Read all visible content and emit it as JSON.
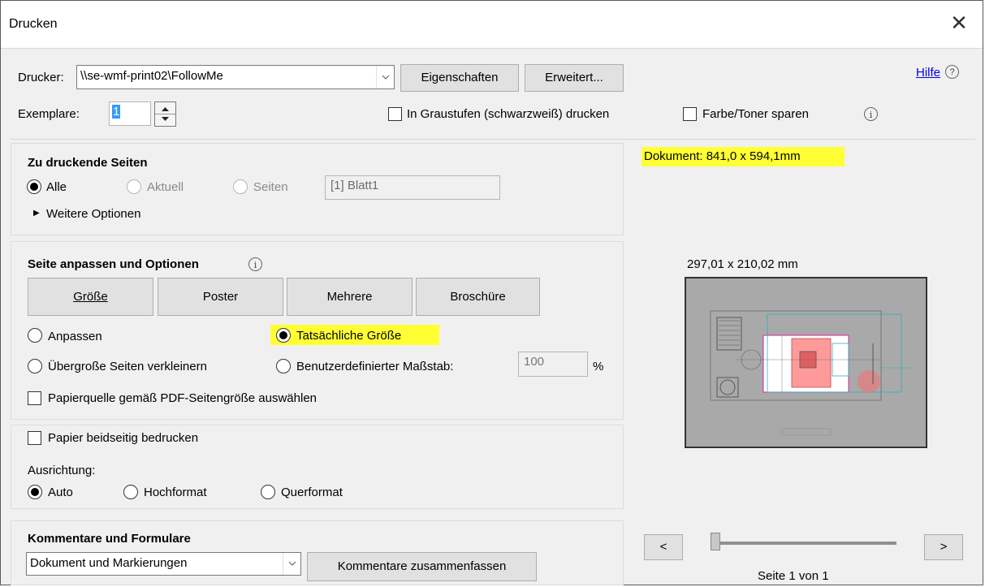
{
  "dialog": {
    "title": "Drucken",
    "close": "✕"
  },
  "top": {
    "printer_label": "Drucker:",
    "printer_value": "\\\\se-wmf-print02\\FollowMe",
    "properties_button": "Eigenschaften",
    "advanced_button": "Erweitert...",
    "help_link": "Hilfe",
    "help_icon": "?",
    "copies_label": "Exemplare:",
    "copies_value": "1",
    "grayscale_label": "In Graustufen (schwarzweiß) drucken",
    "grayscale_checked": false,
    "save_toner_label": "Farbe/Toner sparen",
    "save_toner_checked": false,
    "info_icon": "i"
  },
  "pages": {
    "title": "Zu druckende Seiten",
    "all_label": "Alle",
    "current_label": "Aktuell",
    "pages_label": "Seiten",
    "pages_value": "[1] Blatt1",
    "more_options": "Weitere Optionen",
    "selected": "all"
  },
  "sizing": {
    "title": "Seite anpassen und Optionen",
    "buttons": {
      "size": "Größe",
      "poster": "Poster",
      "multiple": "Mehrere",
      "booklet": "Broschüre"
    },
    "fit_label": "Anpassen",
    "actual_size_label": "Tatsächliche Größe",
    "shrink_label": "Übergroße Seiten verkleinern",
    "custom_scale_label": "Benutzerdefinierter Maßstab:",
    "custom_scale_value": "100",
    "percent": "%",
    "paper_source_label": "Papierquelle gemäß PDF-Seitengröße auswählen",
    "selected": "actual_size"
  },
  "duplex": {
    "duplex_label": "Papier beidseitig bedrucken",
    "orientation_label": "Ausrichtung:",
    "auto_label": "Auto",
    "portrait_label": "Hochformat",
    "landscape_label": "Querformat",
    "selected": "auto"
  },
  "comments": {
    "title": "Kommentare und Formulare",
    "select_value": "Dokument und Markierungen",
    "summarize_button": "Kommentare zusammenfassen"
  },
  "preview": {
    "document_size": "Dokument: 841,0 x 594,1mm",
    "page_size": "297,01 x 210,02 mm",
    "prev_button": "<",
    "next_button": ">",
    "page_indicator": "Seite 1 von 1"
  },
  "colors": {
    "highlight": "#ffff33",
    "link": "#0000ee",
    "preview_bg": "#a9a9a9"
  }
}
